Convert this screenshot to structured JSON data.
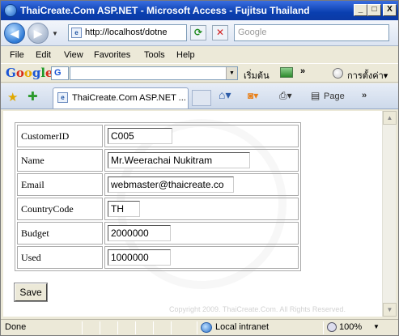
{
  "window": {
    "title": "ThaiCreate.Com ASP.NET - Microsoft Access - Fujitsu Thailand",
    "minimize_glyph": "_",
    "maximize_glyph": "□",
    "close_glyph": "X"
  },
  "navigation": {
    "address": "http://localhost/dotne",
    "search_placeholder": "Google"
  },
  "menu": {
    "items": [
      "File",
      "Edit",
      "View",
      "Favorites",
      "Tools",
      "Help"
    ]
  },
  "google_toolbar": {
    "logo": "Google",
    "engine_glyph": "G",
    "start_label": "เริ่มต้น",
    "more_label": "»",
    "settings_label": "การตั้งค่า▾"
  },
  "tabs": {
    "active_label": "ThaiCreate.Com ASP.NET ...",
    "page_menu_label": "Page",
    "more_label": "»"
  },
  "form": {
    "rows": [
      {
        "label": "CustomerID",
        "value": "C005"
      },
      {
        "label": "Name",
        "value": "Mr.Weerachai Nukitram"
      },
      {
        "label": "Email",
        "value": "webmaster@thaicreate.co"
      },
      {
        "label": "CountryCode",
        "value": "TH"
      },
      {
        "label": "Budget",
        "value": "2000000"
      },
      {
        "label": "Used",
        "value": "1000000"
      }
    ],
    "save_label": "Save"
  },
  "page": {
    "watermark": "Copyright 2009. ThaiCreate.Com. All Rights Reserved."
  },
  "status": {
    "text": "Done",
    "zone": "Local intranet",
    "zoom": "100%"
  },
  "icons": {
    "back": "back-arrow-icon",
    "forward": "forward-arrow-icon",
    "refresh": "refresh-icon",
    "stop": "stop-icon",
    "favorites": "star-icon",
    "add_favorites": "add-favorites-icon",
    "home": "home-icon",
    "feeds": "rss-feed-icon",
    "print": "printer-icon"
  }
}
